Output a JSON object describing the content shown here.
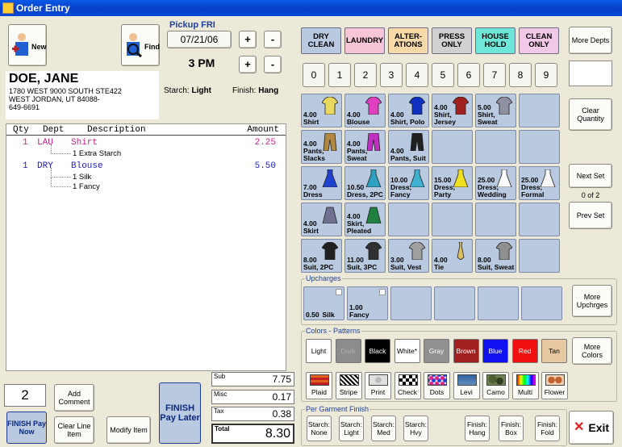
{
  "window": {
    "title": "Order Entry"
  },
  "customer": {
    "new_label": "New",
    "find_label": "Find",
    "name": "DOE, JANE",
    "address1": "1780 WEST 9000 SOUTH STE422",
    "address2": "WEST JORDAN, UT  84088-",
    "phone": "649-6691"
  },
  "pickup": {
    "label": "Pickup FRI",
    "date": "07/21/06",
    "time": "3 PM",
    "plus": "+",
    "minus": "-"
  },
  "starch": {
    "label": "Starch:",
    "value": "Light"
  },
  "finish": {
    "label": "Finish:",
    "value": "Hang"
  },
  "order_table": {
    "header": {
      "qty": "Qty",
      "dept": "Dept",
      "desc": "Description",
      "amount": "Amount"
    },
    "items": [
      {
        "qty": "1",
        "dept": "LAU",
        "desc": "Shirt",
        "amount": "2.25",
        "color": "#d0208a",
        "subs": [
          "1 Extra Starch"
        ]
      },
      {
        "qty": "1",
        "dept": "DRY",
        "desc": "Blouse",
        "amount": "5.50",
        "color": "#2020c8",
        "subs": [
          "1 Silk",
          "1 Fancy"
        ]
      }
    ]
  },
  "bottom": {
    "quantity": "2",
    "add_comment": "Add Comment",
    "finish_pay_now": "FINISH Pay Now",
    "clear_line_item": "Clear Line Item",
    "modify_item": "Modify Item",
    "finish_pay_later": "FINISH Pay Later"
  },
  "totals": {
    "sub_label": "Sub",
    "sub": "7.75",
    "misc_label": "Misc",
    "misc": "0.17",
    "tax_label": "Tax",
    "tax": "0.38",
    "total_label": "Total",
    "total": "8.30"
  },
  "departments": [
    {
      "label": "DRY CLEAN",
      "bg": "#b9c9e0"
    },
    {
      "label": "LAUNDRY",
      "bg": "#f7c6d6"
    },
    {
      "label": "ALTER-ATIONS",
      "bg": "#f8d9a8"
    },
    {
      "label": "PRESS ONLY",
      "bg": "#d0d0d0"
    },
    {
      "label": "HOUSE HOLD",
      "bg": "#6ee6d8"
    },
    {
      "label": "CLEAN ONLY",
      "bg": "#f2c9e6"
    }
  ],
  "more_depts": "More Depts",
  "numbers": [
    "0",
    "1",
    "2",
    "3",
    "4",
    "5",
    "6",
    "7",
    "8",
    "9"
  ],
  "garments": [
    [
      {
        "price": "4.00",
        "name": "Shirt",
        "icon": "shirt-yellow-icon",
        "color": "#e8d860"
      },
      {
        "price": "4.00",
        "name": "Blouse",
        "icon": "blouse-icon",
        "color": "#e040c0"
      },
      {
        "price": "4.00",
        "name": "Shirt, Polo",
        "icon": "polo-shirt-icon",
        "color": "#1030c0"
      },
      {
        "price": "4.00",
        "name": "Shirt, Jersey",
        "icon": "jersey-icon",
        "color": "#a02020"
      },
      {
        "price": "5.00",
        "name": "Shirt, Sweat",
        "icon": "sweatshirt-icon",
        "color": "#9090a0"
      },
      {
        "price": "",
        "name": "",
        "icon": "",
        "color": ""
      }
    ],
    [
      {
        "price": "4.00",
        "name": "Pants, Slacks",
        "icon": "pants-icon",
        "color": "#b08840"
      },
      {
        "price": "4.00",
        "name": "Pants, Sweat",
        "icon": "sweatpants-icon",
        "color": "#c030c0"
      },
      {
        "price": "4.00",
        "name": "Pants, Suit",
        "icon": "suit-pants-icon",
        "color": "#202020"
      },
      {
        "price": "",
        "name": "",
        "icon": "",
        "color": ""
      },
      {
        "price": "",
        "name": "",
        "icon": "",
        "color": ""
      },
      {
        "price": "",
        "name": "",
        "icon": "",
        "color": ""
      }
    ],
    [
      {
        "price": "7.00",
        "name": "Dress",
        "icon": "dress-icon",
        "color": "#2040d0"
      },
      {
        "price": "10.50",
        "name": "Dress, 2PC",
        "icon": "dress-2pc-icon",
        "color": "#30a0c0"
      },
      {
        "price": "10.00",
        "name": "Dress, Fancy",
        "icon": "fancy-dress-icon",
        "color": "#40b0d0"
      },
      {
        "price": "15.00",
        "name": "Dress, Party",
        "icon": "party-dress-icon",
        "color": "#f0e020"
      },
      {
        "price": "25.00",
        "name": "Dress, Wedding",
        "icon": "wedding-dress-icon",
        "color": "#ffffff"
      },
      {
        "price": "25.00",
        "name": "Dress, Formal",
        "icon": "formal-dress-icon",
        "color": "#f8f8f8"
      }
    ],
    [
      {
        "price": "4.00",
        "name": "Skirt",
        "icon": "skirt-icon",
        "color": "#707090"
      },
      {
        "price": "4.00",
        "name": "Skirt, Pleated",
        "icon": "pleated-skirt-icon",
        "color": "#208040"
      },
      {
        "price": "",
        "name": "",
        "icon": "",
        "color": ""
      },
      {
        "price": "",
        "name": "",
        "icon": "",
        "color": ""
      },
      {
        "price": "",
        "name": "",
        "icon": "",
        "color": ""
      },
      {
        "price": "",
        "name": "",
        "icon": "",
        "color": ""
      }
    ],
    [
      {
        "price": "8.00",
        "name": "Suit, 2PC",
        "icon": "suit-2pc-icon",
        "color": "#202020"
      },
      {
        "price": "11.00",
        "name": "Suit, 3PC",
        "icon": "suit-3pc-icon",
        "color": "#303030"
      },
      {
        "price": "3.00",
        "name": "Suit, Vest",
        "icon": "vest-icon",
        "color": "#a0a0a0"
      },
      {
        "price": "4.00",
        "name": "Tie",
        "icon": "tie-icon",
        "color": "#d8c060"
      },
      {
        "price": "8.00",
        "name": "Suit, Sweat",
        "icon": "sweat-suit-icon",
        "color": "#909090"
      },
      {
        "price": "",
        "name": "",
        "icon": "",
        "color": ""
      }
    ]
  ],
  "clear_quantity": "Clear Quantity",
  "next_set": "Next Set",
  "set_indicator": "0 of 2",
  "prev_set": "Prev Set",
  "upcharges": {
    "title": "Upcharges",
    "items": [
      {
        "price": "0.50",
        "name": "Silk"
      },
      {
        "price": "1.00",
        "name": "Fancy"
      },
      {
        "price": "",
        "name": ""
      },
      {
        "price": "",
        "name": ""
      },
      {
        "price": "",
        "name": ""
      },
      {
        "price": "",
        "name": ""
      }
    ],
    "more": "More Upchrges"
  },
  "colors": {
    "title": "Colors - Patterns",
    "items": [
      {
        "label": "Light",
        "bg": "#ffffff",
        "fg": "#000000"
      },
      {
        "label": "Dark",
        "bg": "#8c8c8c",
        "fg": "#b0b0b0"
      },
      {
        "label": "Black",
        "bg": "#000000",
        "fg": "#ffffff"
      },
      {
        "label": "White*",
        "bg": "#ffffff",
        "fg": "#000000"
      },
      {
        "label": "Gray",
        "bg": "#909090",
        "fg": "#ffffff"
      },
      {
        "label": "Brown",
        "bg": "#a02020",
        "fg": "#ffffff"
      },
      {
        "label": "Blue",
        "bg": "#1010f0",
        "fg": "#ffffff"
      },
      {
        "label": "Red",
        "bg": "#f01010",
        "fg": "#ffffff"
      },
      {
        "label": "Tan",
        "bg": "#e8c8a0",
        "fg": "#000000"
      }
    ],
    "more": "More Colors"
  },
  "patterns": [
    {
      "label": "Plaid",
      "icon": "plaid-icon"
    },
    {
      "label": "Stripe",
      "icon": "stripe-icon"
    },
    {
      "label": "Print",
      "icon": "print-icon"
    },
    {
      "label": "Check",
      "icon": "check-pattern-icon"
    },
    {
      "label": "Dots",
      "icon": "dots-icon"
    },
    {
      "label": "Levi",
      "icon": "levi-icon"
    },
    {
      "label": "Camo",
      "icon": "camo-icon"
    },
    {
      "label": "Multi",
      "icon": "multi-icon"
    },
    {
      "label": "Flower",
      "icon": "flower-icon"
    }
  ],
  "per_garment": {
    "title": "Per Garment Finish",
    "starch": [
      "Starch: None",
      "Starch: Light",
      "Starch: Med",
      "Starch: Hvy"
    ],
    "finish": [
      "Finish: Hang",
      "Finish: Box",
      "Finish: Fold"
    ]
  },
  "exit_label": "Exit"
}
